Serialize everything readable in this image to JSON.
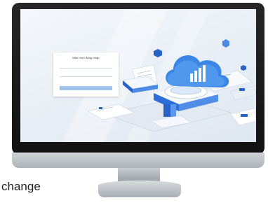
{
  "caption": "change",
  "login_form": {
    "title": "Màn hình đăng nhập"
  },
  "colors": {
    "bezel": "#1a1a1a",
    "cloud": "#3a86e6",
    "accent_blue": "#2a63c8",
    "button": "#9fc3ea",
    "screen_bg": "#eef2f7"
  },
  "icons": [
    "cloud-icon",
    "bar-chart-icon",
    "hexagon-icon",
    "server-icon",
    "document-icon"
  ]
}
